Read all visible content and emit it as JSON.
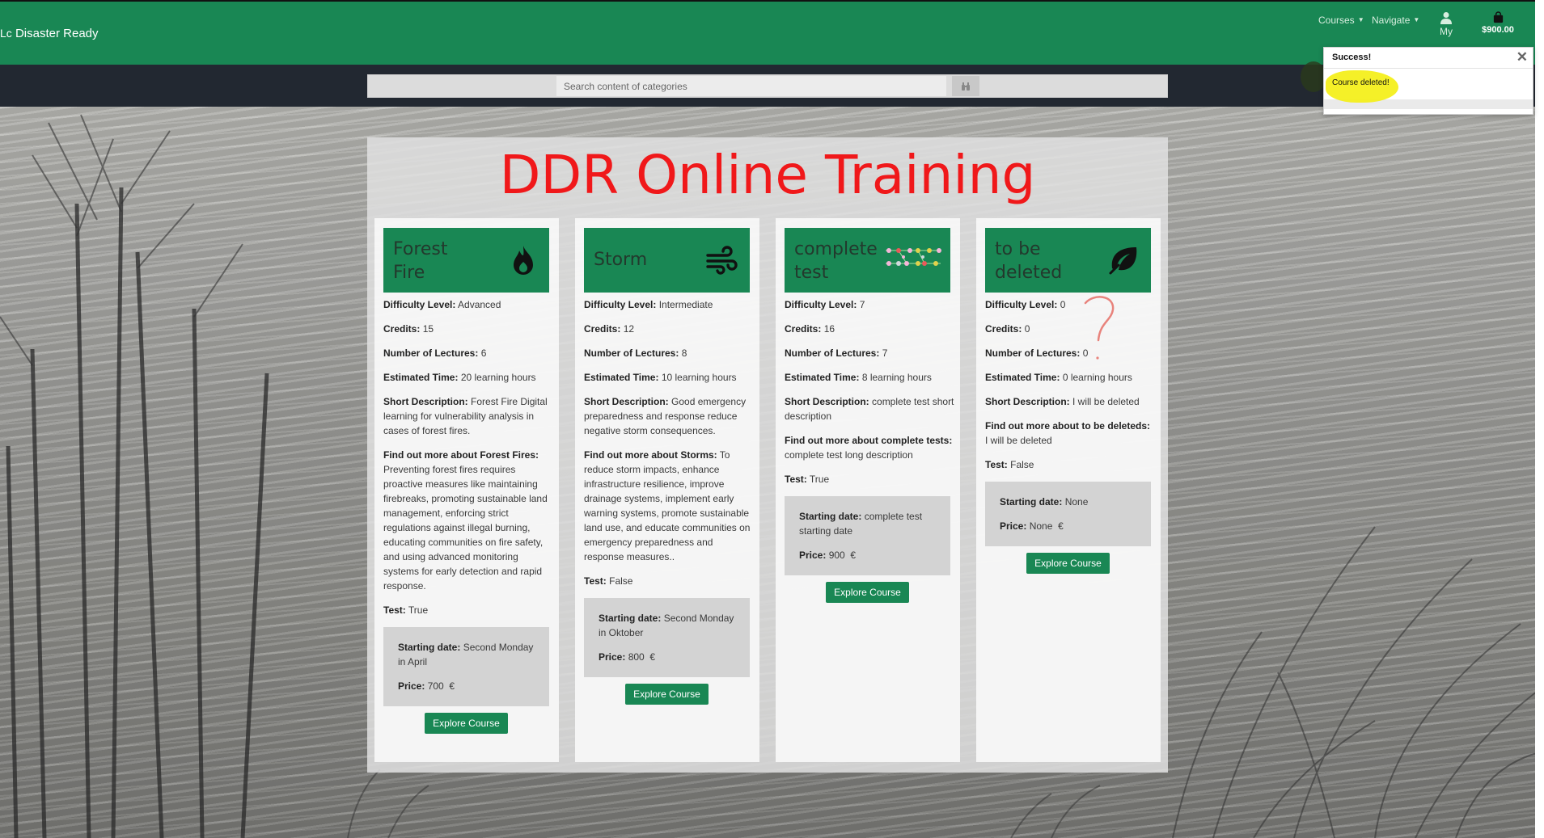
{
  "navbar": {
    "brand_img_alt": "Lc",
    "brand_text": "Disaster Ready",
    "courses_label": "Courses",
    "navigate_label": "Navigate",
    "my_label": "My",
    "cart_total": "$900.00"
  },
  "search": {
    "placeholder": "Search content of categories"
  },
  "toast": {
    "title": "Success!",
    "message": "Course deleted!"
  },
  "page": {
    "title": "DDR Online Training"
  },
  "courses": [
    {
      "title": "Forest Fire",
      "icon": "fire-icon",
      "difficulty_label": "Difficulty Level:",
      "difficulty": "Advanced",
      "credits_label": "Credits:",
      "credits": "15",
      "lectures_label": "Number of Lectures:",
      "lectures": "6",
      "time_label": "Estimated Time:",
      "time": "20 learning hours",
      "short_label": "Short Description:",
      "short_desc": "Forest Fire Digital learning for vulnerability analysis in cases of forest fires.",
      "more_label": "Find out more about Forest Fires:",
      "more_desc": "Preventing forest fires requires proactive measures like maintaining firebreaks, promoting sustainable land management, enforcing strict regulations against illegal burning, educating communities on fire safety, and using advanced monitoring systems for early detection and rapid response.",
      "test_label": "Test:",
      "test": "True",
      "start_label": "Starting date:",
      "start": "Second Monday in April",
      "price_label": "Price:",
      "price": "700",
      "currency": "€",
      "button": "Explore Course"
    },
    {
      "title": "Storm",
      "icon": "wind-icon",
      "difficulty_label": "Difficulty Level:",
      "difficulty": "Intermediate",
      "credits_label": "Credits:",
      "credits": "12",
      "lectures_label": "Number of Lectures:",
      "lectures": "8",
      "time_label": "Estimated Time:",
      "time": "10 learning hours",
      "short_label": "Short Description:",
      "short_desc": "Good emergency preparedness and response reduce negative storm consequences.",
      "more_label": "Find out more about Storms:",
      "more_desc": "To reduce storm impacts, enhance infrastructure resilience, improve drainage systems, implement early warning systems, promote sustainable land use, and educate communities on emergency preparedness and response measures..",
      "test_label": "Test:",
      "test": "False",
      "start_label": "Starting date:",
      "start": "Second Monday in Oktober",
      "price_label": "Price:",
      "price": "800",
      "currency": "€",
      "button": "Explore Course"
    },
    {
      "title": "complete test",
      "icon": "diagram-image",
      "difficulty_label": "Difficulty Level:",
      "difficulty": "7",
      "credits_label": "Credits:",
      "credits": "16",
      "lectures_label": "Number of Lectures:",
      "lectures": "7",
      "time_label": "Estimated Time:",
      "time": "8 learning hours",
      "short_label": "Short Description:",
      "short_desc": "complete test short description",
      "more_label": "Find out more about complete tests:",
      "more_desc": "complete test long description",
      "test_label": "Test:",
      "test": "True",
      "start_label": "Starting date:",
      "start": "complete test starting date",
      "price_label": "Price:",
      "price": "900",
      "currency": "€",
      "button": "Explore Course"
    },
    {
      "title": "to be deleted",
      "icon": "leaf-icon",
      "difficulty_label": "Difficulty Level:",
      "difficulty": "0",
      "credits_label": "Credits:",
      "credits": "0",
      "lectures_label": "Number of Lectures:",
      "lectures": "0",
      "time_label": "Estimated Time:",
      "time": "0 learning hours",
      "short_label": "Short Description:",
      "short_desc": "I will be deleted",
      "more_label": "Find out more about to be deleteds:",
      "more_desc": "I will be deleted",
      "test_label": "Test:",
      "test": "False",
      "start_label": "Starting date:",
      "start": "None",
      "price_label": "Price:",
      "price": "None",
      "currency": "€",
      "button": "Explore Course"
    }
  ],
  "colors": {
    "brand_green": "#198754",
    "title_red": "#f0181a",
    "dark_bar": "#222831",
    "highlight_yellow": "#f4ef1c"
  }
}
